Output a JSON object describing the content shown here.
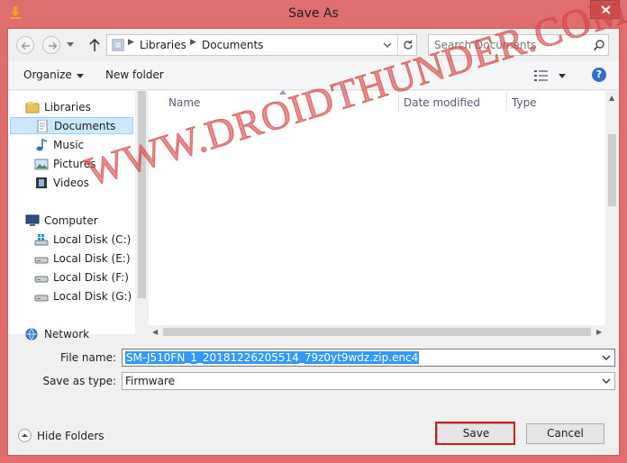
{
  "window": {
    "title": "Save As"
  },
  "address": {
    "crumbs": [
      "Libraries",
      "Documents"
    ]
  },
  "search": {
    "placeholder": "Search Documents"
  },
  "toolbar": {
    "organize_label": "Organize",
    "new_folder_label": "New folder",
    "help_glyph": "?"
  },
  "nav": {
    "items": [
      {
        "label": "Libraries",
        "icon": "libraries-icon"
      },
      {
        "label": "Documents",
        "icon": "documents-icon",
        "selected": true
      },
      {
        "label": "Music",
        "icon": "music-icon"
      },
      {
        "label": "Pictures",
        "icon": "pictures-icon"
      },
      {
        "label": "Videos",
        "icon": "videos-icon"
      },
      {
        "label": "Computer",
        "icon": "computer-icon"
      },
      {
        "label": "Local Disk (C:)",
        "icon": "drive-c-icon"
      },
      {
        "label": "Local Disk (E:)",
        "icon": "drive-icon"
      },
      {
        "label": "Local Disk (F:)",
        "icon": "drive-icon"
      },
      {
        "label": "Local Disk (G:)",
        "icon": "drive-icon"
      },
      {
        "label": "Network",
        "icon": "network-icon"
      }
    ]
  },
  "columns": [
    "Name",
    "Date modified",
    "Type"
  ],
  "watermark": "WWW.DROIDTHUNDER.COM",
  "form": {
    "file_name_label": "File name:",
    "file_name_value": "SM-J510FN_1_20181226205514_79z0yt9wdz.zip.enc4",
    "save_type_label": "Save as type:",
    "save_type_value": "Firmware"
  },
  "footer": {
    "hide_folders_label": "Hide Folders",
    "save_label": "Save",
    "cancel_label": "Cancel"
  },
  "colors": {
    "frame": "#e06e6e",
    "selection": "#3399ff",
    "highlight_box": "#d21c1c"
  }
}
